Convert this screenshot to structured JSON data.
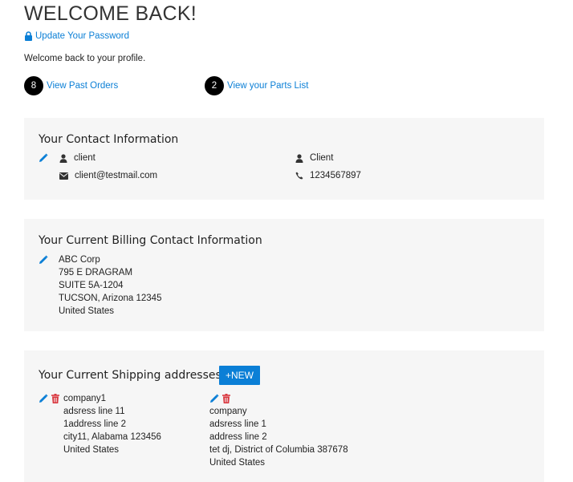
{
  "page": {
    "title": "WELCOME BACK!",
    "update_password": "Update Your Password",
    "intro": "Welcome back to your profile."
  },
  "links": {
    "past_orders_count": "8",
    "past_orders_label": "View Past Orders",
    "parts_count": "2",
    "parts_label": "View your Parts List"
  },
  "contact": {
    "title": "Your Contact Information",
    "username": "client",
    "email": "client@testmail.com",
    "name": "Client",
    "phone": "1234567897"
  },
  "billing": {
    "title": "Your Current Billing Contact Information",
    "lines": [
      "ABC Corp",
      "795 E DRAGRAM",
      "SUITE 5A-1204",
      "TUCSON, Arizona 12345",
      "United States"
    ]
  },
  "shipping": {
    "title": "Your Current Shipping addresses",
    "new_label": "+NEW",
    "addresses": [
      {
        "lines": [
          "company1",
          "adsress line 11",
          "1address line 2",
          "city11, Alabama 123456",
          "United States"
        ]
      },
      {
        "lines": [
          "company",
          "adsress line 1",
          "address line 2",
          "tet dj, District of Columbia 387678",
          "United States"
        ]
      }
    ]
  },
  "colors": {
    "accent": "#0b7fd6",
    "danger": "#d9363e",
    "panel_bg": "#f6f6f6"
  }
}
